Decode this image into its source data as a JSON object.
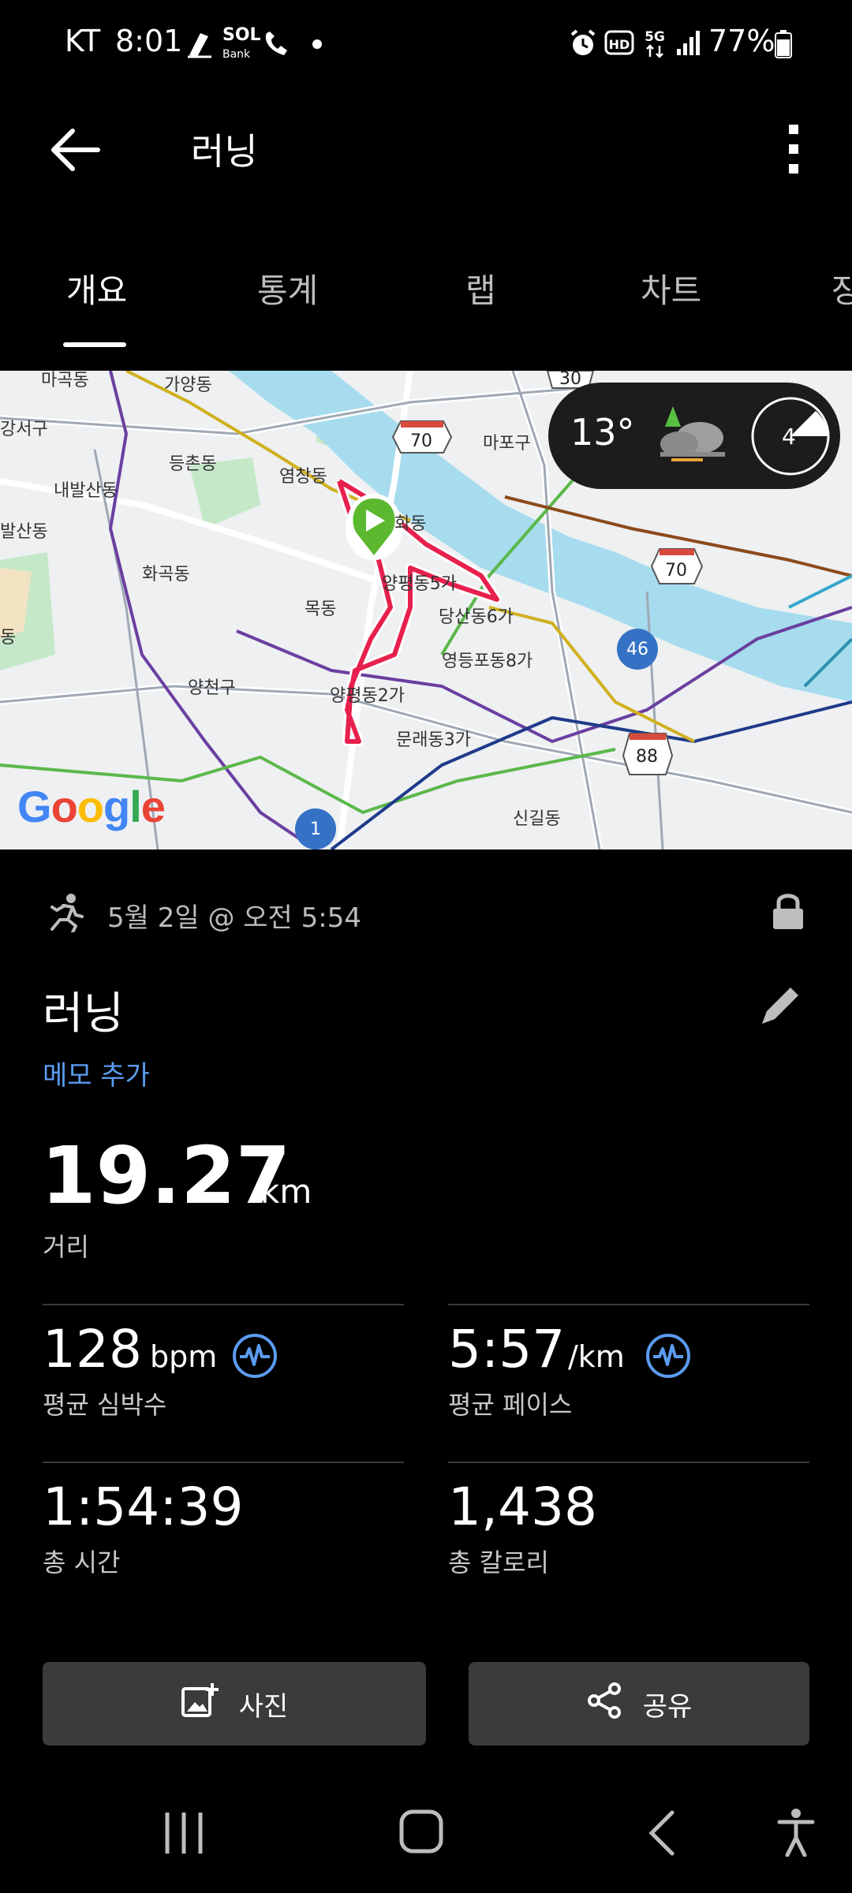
{
  "status_bar": {
    "carrier": "KT",
    "time": "8:01",
    "sol_label": "SOL",
    "bank_label": "Bank",
    "battery": "77%"
  },
  "app_bar": {
    "title": "러닝"
  },
  "tabs": [
    {
      "label": "개요",
      "active": true
    },
    {
      "label": "통계",
      "active": false
    },
    {
      "label": "랩",
      "active": false
    },
    {
      "label": "차트",
      "active": false
    },
    {
      "label": "장",
      "active": false
    }
  ],
  "map": {
    "labels": {
      "gayang": "가양동",
      "mapo": "마포구",
      "gangseo": "강서구",
      "deungchon": "등촌동",
      "yeomchang": "염창동",
      "naebalsan": "내발산동",
      "balsan": "발산동",
      "hwagok": "화곡동",
      "mok": "목동",
      "yangpyeong5": "양평동5가",
      "dangsan6": "당산동6가",
      "yeongdeungpo8": "영등포동8가",
      "yangcheon": "양천구",
      "yangpyeong2": "양평동2가",
      "mullae3": "문래동3가",
      "singil": "신길동",
      "dong": "동",
      "hwa": "화동",
      "top_left": "마곡동"
    },
    "shields": {
      "r70_top": "70",
      "r70_right": "70",
      "r88": "88",
      "r30": "30",
      "r46": "46",
      "r1": "1"
    },
    "google": {
      "text": "Google",
      "colors": [
        "#4285F4",
        "#EA4335",
        "#FBBC05",
        "#4285F4",
        "#34A853",
        "#EA4335"
      ]
    },
    "weather": {
      "temperature": "13°",
      "wind": "4"
    }
  },
  "activity": {
    "date": "5월 2일 @ 오전 5:54",
    "title": "러닝",
    "memo_link": "메모 추가",
    "distance": {
      "value": "19.27",
      "unit": "km",
      "label": "거리"
    },
    "heart_rate": {
      "value": "128",
      "unit": "bpm",
      "label": "평균 심박수"
    },
    "pace": {
      "value": "5:57",
      "unit": "/km",
      "label": "평균 페이스"
    },
    "duration": {
      "value": "1:54:39",
      "label": "총 시간"
    },
    "calories": {
      "value": "1,438",
      "label": "총 칼로리"
    }
  },
  "actions": {
    "photo": "사진",
    "share": "공유"
  },
  "colors": {
    "accent": "#5b9cf0",
    "route": "#e8204e",
    "start_pin": "#5cb82e",
    "river": "#a6dcee"
  }
}
